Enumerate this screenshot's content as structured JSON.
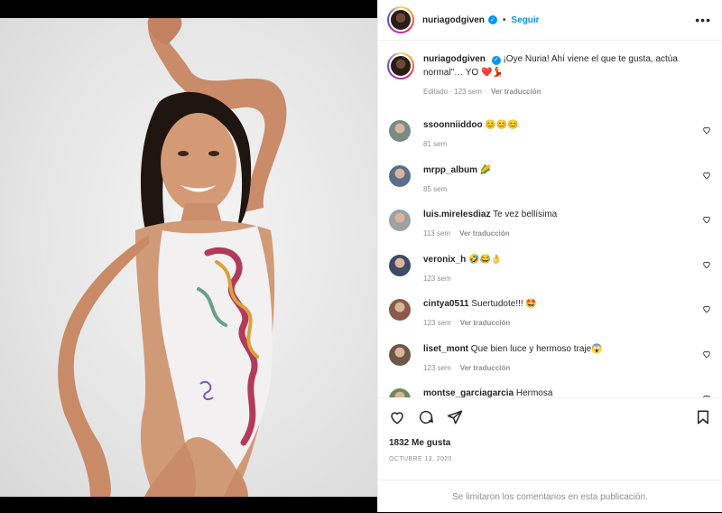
{
  "header": {
    "username": "nuriagodgiven",
    "follow_label": "Seguir",
    "more_label": "•••"
  },
  "caption": {
    "username": "nuriagodgiven",
    "text": "¡Oye Nuria! Ahí viene el que te gusta, actúa normal\"… YO ❤️💃",
    "edited": "Editado · 123 sem",
    "translate": "Ver traducción"
  },
  "comments": [
    {
      "username": "ssoonniiddoo",
      "text": "😊😊😊",
      "time": "81 sem",
      "translate": "",
      "avatar_color": "#7a8a86"
    },
    {
      "username": "mrpp_album",
      "text": "🌽",
      "time": "85 sem",
      "translate": "",
      "avatar_color": "#5b6f8a"
    },
    {
      "username": "luis.mirelesdiaz",
      "text": "Te vez bellísima",
      "time": "113 sem",
      "translate": "Ver traducción",
      "avatar_color": "#9aa2a6"
    },
    {
      "username": "veronix_h",
      "text": "🤣😂👌",
      "time": "123 sem",
      "translate": "",
      "avatar_color": "#3e4a66"
    },
    {
      "username": "cintya0511",
      "text": "Suertudote!!! 🤩",
      "time": "123 sem",
      "translate": "Ver traducción",
      "avatar_color": "#8a5a4a"
    },
    {
      "username": "liset_mont",
      "text": "Que bien luce y hermoso traje😱",
      "time": "123 sem",
      "translate": "Ver traducción",
      "avatar_color": "#6e5648"
    },
    {
      "username": "montse_garciagarcia",
      "text": "Hermosa",
      "time": "",
      "translate": "",
      "avatar_color": "#6e8a5a"
    }
  ],
  "actions": {
    "likes": "1832 Me gusta",
    "date": "OCTUBRE 13, 2020",
    "comments_limited": "Se limitaron los comentarios en esta publicación."
  },
  "colors": {
    "accent": "#0095f6",
    "muted": "#8e8e8e"
  }
}
